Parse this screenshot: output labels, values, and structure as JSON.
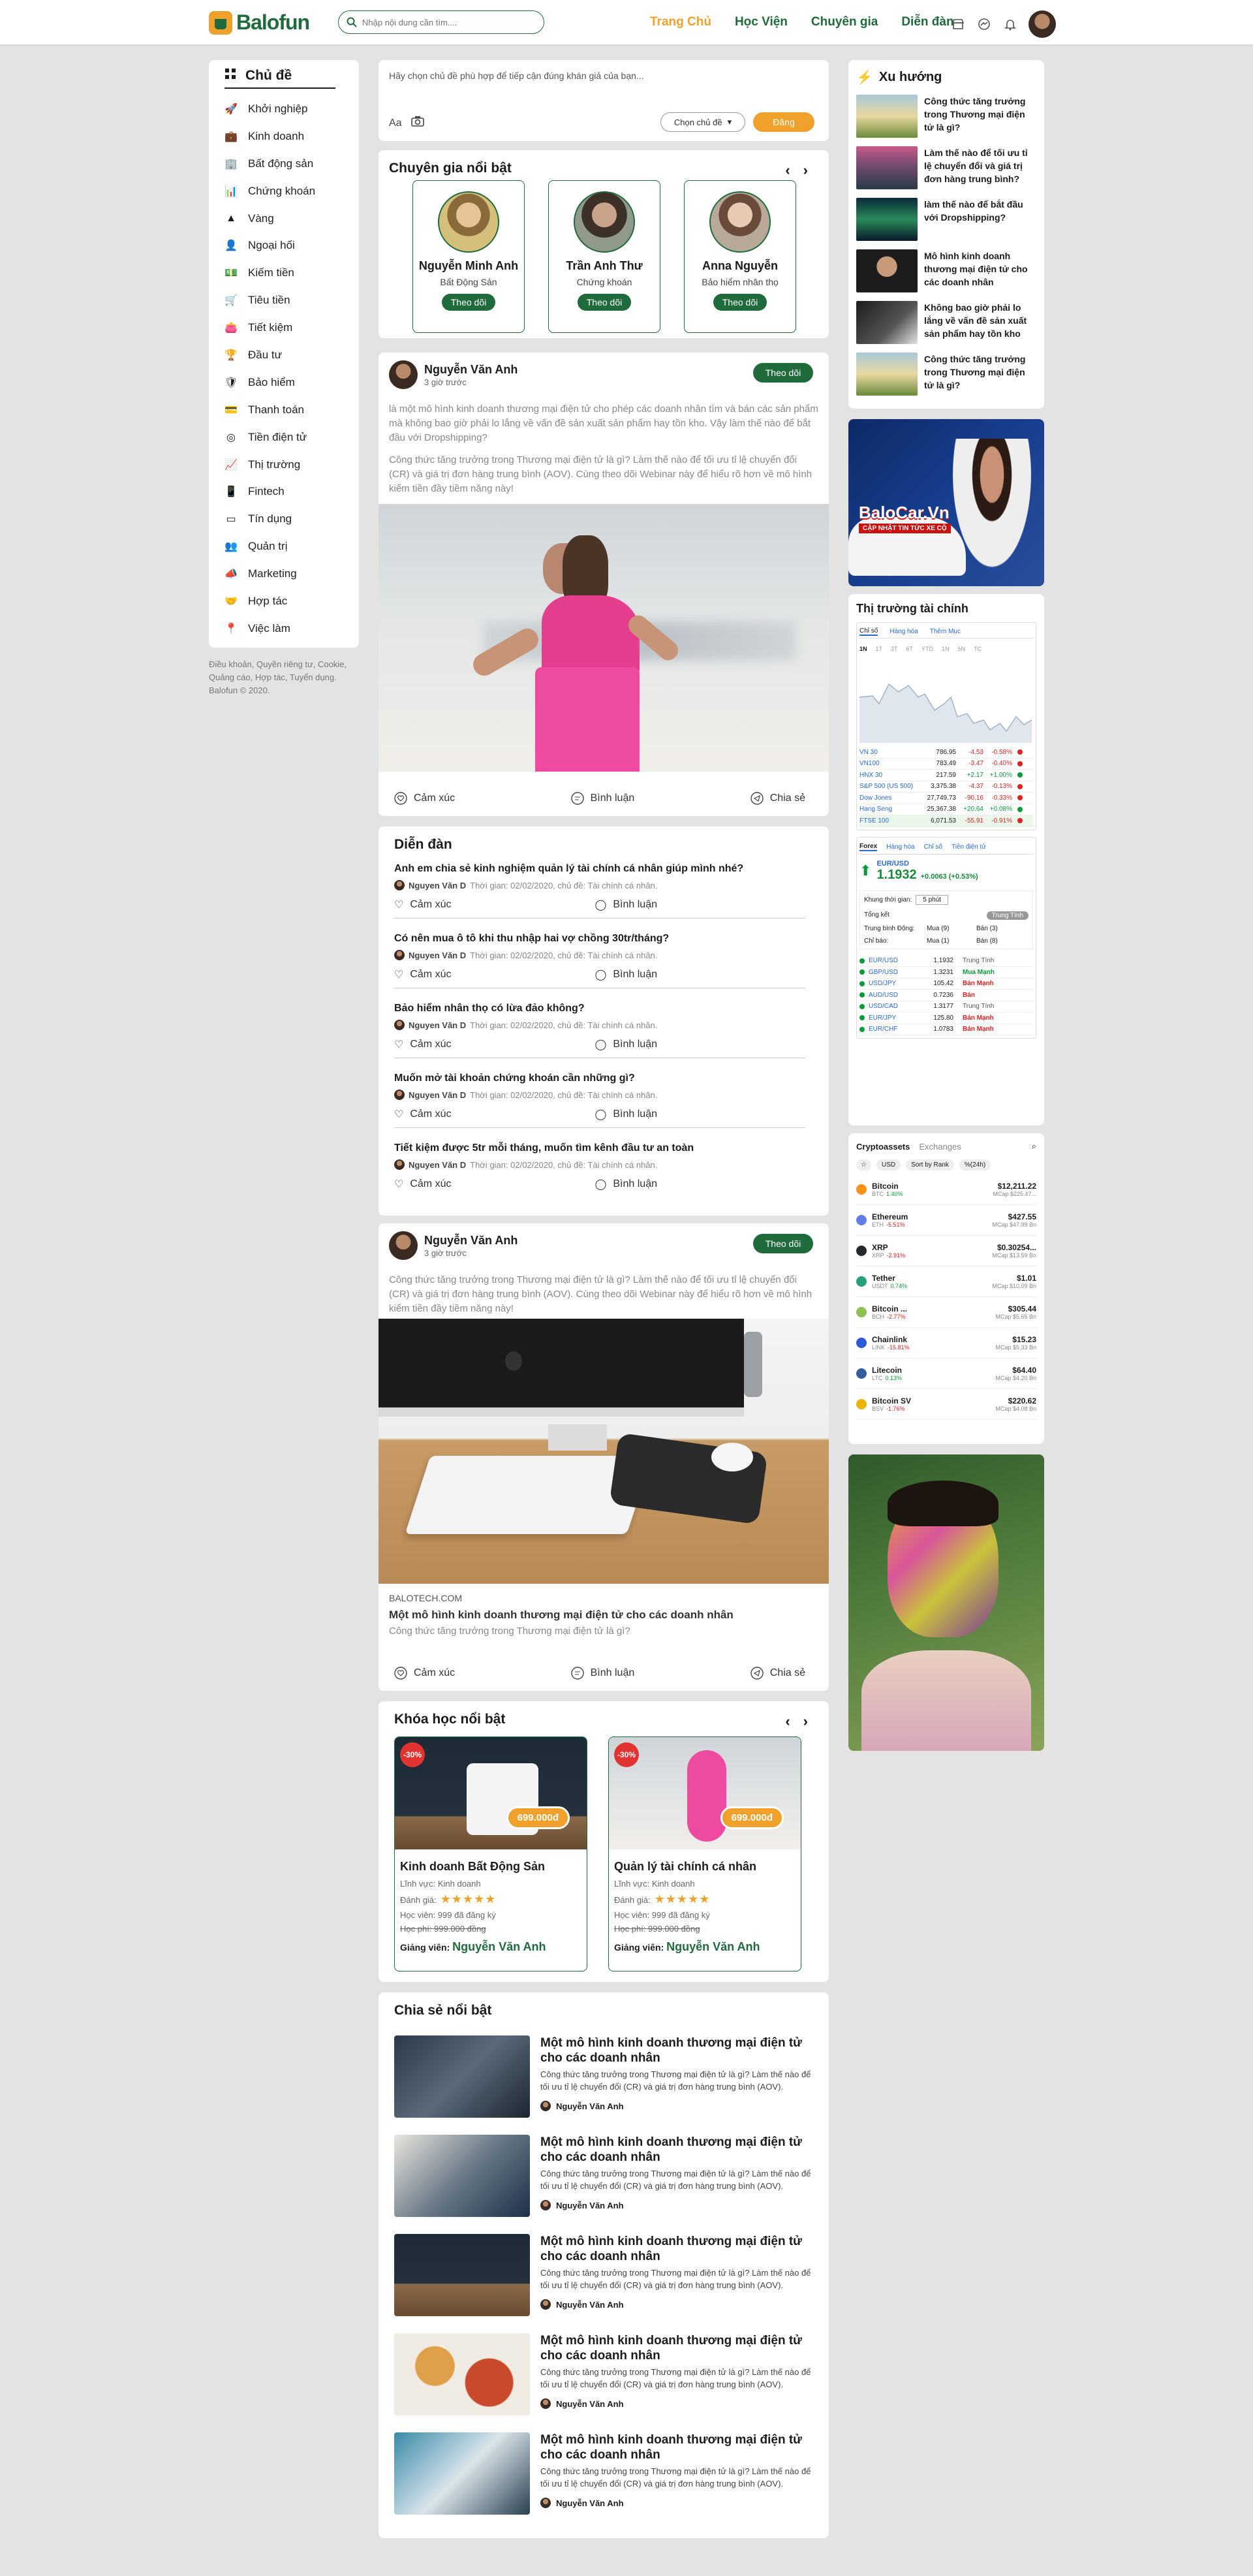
{
  "header": {
    "logo": "Balofun",
    "search_placeholder": "Nhập nội dung cần tìm....",
    "nav": [
      "Trang Chủ",
      "Học Viện",
      "Chuyên gia",
      "Diễn đàn"
    ]
  },
  "sidebar": {
    "title": "Chủ đề",
    "items": [
      "Khởi nghiệp",
      "Kinh doanh",
      "Bất động sản",
      "Chứng khoán",
      "Vàng",
      "Ngoại hối",
      "Kiếm tiền",
      "Tiêu tiền",
      "Tiết kiệm",
      "Đầu tư",
      "Bảo hiểm",
      "Thanh toán",
      "Tiền điện tử",
      "Thị trường",
      "Fintech",
      "Tín dụng",
      "Quản trị",
      "Marketing",
      "Hợp tác",
      "Việc làm"
    ],
    "icons": [
      "rocket-icon",
      "bag-icon",
      "building-icon",
      "chart-icon",
      "gold-icon",
      "person-icon",
      "person-money-icon",
      "cart-icon",
      "wallet-icon",
      "trophy-icon",
      "shield-icon",
      "card-icon",
      "coin-icon",
      "trend-icon",
      "phone-icon",
      "card2-icon",
      "people-icon",
      "megaphone-icon",
      "handshake-icon",
      "location-icon"
    ]
  },
  "footer": "Điều khoản, Quyền riêng tư, Cookie, Quảng cáo, Hợp tác, Tuyển dụng. Balofun © 2020.",
  "composer": {
    "placeholder": "Hãy chọn chủ đề phù hợp để tiếp cận đúng khán giả của bạn...",
    "aa": "Aa",
    "select": "Chọn chủ đề",
    "post": "Đăng"
  },
  "experts": {
    "title": "Chuyên gia nổi bật",
    "items": [
      {
        "name": "Nguyễn Minh Anh",
        "field": "Bất Động Sản",
        "follow": "Theo dõi"
      },
      {
        "name": "Trần Anh Thư",
        "field": "Chứng khoán",
        "follow": "Theo dõi"
      },
      {
        "name": "Anna Nguyễn",
        "field": "Bảo hiểm nhân thọ",
        "follow": "Theo dõi"
      }
    ]
  },
  "post1": {
    "author": "Nguyễn Văn Anh",
    "time": "3 giờ trước",
    "follow": "Theo dõi",
    "p1": "là một mô hình kinh doanh thương mại điện tử cho phép các doanh nhân tìm và bán các sản phẩm mà không bao giờ phải lo lắng về vấn đề sản xuất sản phẩm hay tồn kho. Vậy làm thế nào để bắt  đầu với Dropshipping?",
    "p2": "Công thức tăng trưởng trong Thương mại điện tử là gì? Làm thế nào để tối ưu tỉ lệ chuyển đổi (CR) và giá trị đơn hàng trung bình (AOV). Cùng theo dõi Webinar này để hiểu rõ hơn về mô hình kiếm tiền đầy tiềm năng này!",
    "actions": [
      "Cảm xúc",
      "Bình luận",
      "Chia sẻ"
    ]
  },
  "forum": {
    "title": "Diễn đàn",
    "items": [
      {
        "q": "Anh em chia sẻ kinh nghiệm quản lý tài chính cá nhân giúp mình nhé?",
        "author": "Nguyen Văn D",
        "meta": "Thời gian: 02/02/2020, chủ đề: Tài chính cá nhân."
      },
      {
        "q": "Có nên mua ô tô khi thu nhập hai vợ chồng 30tr/tháng?",
        "author": "Nguyen Văn D",
        "meta": "Thời gian: 02/02/2020, chủ đề: Tài chính cá nhân."
      },
      {
        "q": "Bảo hiểm nhân thọ có lừa đảo không?",
        "author": "Nguyen Văn D",
        "meta": "Thời gian: 02/02/2020, chủ đề: Tài chính cá nhân."
      },
      {
        "q": "Muốn mở tài khoản chứng khoán cần những gì?",
        "author": "Nguyen Văn D",
        "meta": "Thời gian: 02/02/2020, chủ đề: Tài chính cá nhân."
      },
      {
        "q": "Tiết kiệm được 5tr mỗi tháng, muốn tìm kênh đầu tư an toàn",
        "author": "Nguyen Văn D",
        "meta": "Thời gian: 02/02/2020, chủ đề: Tài chính cá nhân."
      }
    ],
    "actions": [
      "Cảm xúc",
      "Bình luận"
    ]
  },
  "post2": {
    "author": "Nguyễn Văn Anh",
    "time": "3 giờ trước",
    "follow": "Theo dõi",
    "p": "Công thức tăng trưởng trong Thương mại điện tử là gì? Làm thế nào để tối ưu tỉ lệ chuyển đổi (CR) và giá trị đơn hàng trung bình (AOV). Cùng theo dõi Webinar này để hiểu rõ hơn về mô hình kiếm tiền đầy tiềm năng này!",
    "domain": "BALOTECH.COM",
    "link_title": "Một mô hình kinh doanh thương mại điện tử cho các doanh nhân",
    "link_desc": "Công thức tăng trưởng trong Thương mại điện tử là gì?",
    "actions": [
      "Cảm xúc",
      "Bình luận",
      "Chia sẻ"
    ]
  },
  "courses": {
    "title": "Khóa học nổi bật",
    "items": [
      {
        "disc": "-30%",
        "price": "699.000đ",
        "name": "Kinh doanh Bất Động Sản",
        "field": "Lĩnh vực: Kinh doanh",
        "rating_label": "Đánh giá:",
        "rating": 5,
        "students": "Học viên: 999 đã đăng ký",
        "old_price": "Học phí: 999.000 đồng",
        "teacher_label": "Giảng viên:",
        "teacher": "Nguyễn Văn Anh"
      },
      {
        "disc": "-30%",
        "price": "699.000đ",
        "name": "Quản lý tài chính cá nhân",
        "field": "Lĩnh vực: Kinh doanh",
        "rating_label": "Đánh giá:",
        "rating": 5,
        "students": "Học viên: 999 đã đăng ký",
        "old_price": "Học phí: 999.000 đồng",
        "teacher_label": "Giảng viên:",
        "teacher": "Nguyễn Văn Anh"
      }
    ]
  },
  "shares": {
    "title": "Chia sẻ nổi bật",
    "items": [
      {
        "title": "Một mô hình kinh doanh thương mại điện tử cho các doanh nhân",
        "desc": "Công thức tăng trưởng trong Thương mại điện tử là gì? Làm thế nào để tối ưu tỉ lệ chuyển đổi (CR) và giá trị đơn hàng trung bình (AOV).",
        "author": "Nguyễn Văn Anh"
      },
      {
        "title": "Một mô hình kinh doanh thương mại điện tử cho các doanh nhân",
        "desc": "Công thức tăng trưởng trong Thương mại điện tử là gì? Làm thế nào để tối ưu tỉ lệ chuyển đổi (CR) và giá trị đơn hàng trung bình (AOV).",
        "author": "Nguyễn Văn Anh"
      },
      {
        "title": "Một mô hình kinh doanh thương mại điện tử cho các doanh nhân",
        "desc": "Công thức tăng trưởng trong Thương mại điện tử là gì? Làm thế nào để tối ưu tỉ lệ chuyển đổi (CR) và giá trị đơn hàng trung bình (AOV).",
        "author": "Nguyễn Văn Anh"
      },
      {
        "title": "Một mô hình kinh doanh thương mại điện tử cho các doanh nhân",
        "desc": "Công thức tăng trưởng trong Thương mại điện tử là gì? Làm thế nào để tối ưu tỉ lệ chuyển đổi (CR) và giá trị đơn hàng trung bình (AOV).",
        "author": "Nguyễn Văn Anh"
      },
      {
        "title": "Một mô hình kinh doanh thương mại điện tử cho các doanh nhân",
        "desc": "Công thức tăng trưởng trong Thương mại điện tử là gì? Làm thế nào để tối ưu tỉ lệ chuyển đổi (CR) và giá trị đơn hàng trung bình (AOV).",
        "author": "Nguyễn Văn Anh"
      }
    ]
  },
  "trend": {
    "title": "Xu hướng",
    "items": [
      "Công thức tăng trưởng trong Thương mại điện tử là gì?",
      "Làm thế nào để tối ưu tỉ lệ chuyển đổi và giá trị đơn hàng trung bình?",
      "làm thế nào để bắt  đầu với Dropshipping?",
      "Mô hình kinh doanh thương mại điện tử cho các doanh nhân",
      "Không bao giờ phải lo lắng về vấn đề sản xuất sản phẩm hay tồn kho",
      "Công thức tăng trưởng trong Thương mại điện tử là gì?"
    ]
  },
  "ad1": {
    "brand": "BaloCar.Vn",
    "tag": "CẬP NHẬT TIN TỨC XE CỘ"
  },
  "market": {
    "title": "Thị trường tài chính",
    "tabs": [
      "Chỉ số",
      "Hàng hóa",
      "Thêm Mục"
    ],
    "periods": [
      "1N",
      "1T",
      "3T",
      "6T",
      "YTD",
      "1N",
      "5N",
      "TC"
    ],
    "rows": [
      [
        "VN 30",
        "786.95",
        "-4.53",
        "-0.58%"
      ],
      [
        "VN100",
        "783.49",
        "-3.47",
        "-0.40%"
      ],
      [
        "HNX 30",
        "217.59",
        "+2.17",
        "+1.00%"
      ],
      [
        "S&P 500 (US 500)",
        "3,375.38",
        "-4.37",
        "-0.13%"
      ],
      [
        "Dow Jones",
        "27,749.73",
        "-90.16",
        "-0.33%"
      ],
      [
        "Hang Seng",
        "25,367.38",
        "+20.64",
        "+0.08%"
      ],
      [
        "FTSE 100",
        "6,071.53",
        "-55.91",
        "-0.91%"
      ]
    ],
    "fx_tabs": [
      "Forex",
      "Hàng hóa",
      "Chỉ số",
      "Tiền điện tử"
    ],
    "pair": "EUR/USD",
    "price": "1.1932",
    "change": "+0.0063 (+0.53%)",
    "timeframe_label": "Khung thời gian:",
    "timeframe": "5 phút",
    "summary_label": "Tổng kết",
    "summary_value": "Trung Tính",
    "ma_label": "Trung bình Động:",
    "ma_buy": "Mua (9)",
    "ma_sell": "Bán (3)",
    "ind_label": "Chỉ báo:",
    "ind_buy": "Mua (1)",
    "ind_sell": "Bán (8)",
    "fx_rows": [
      [
        "EUR/USD",
        "1.1932",
        "Trung Tính"
      ],
      [
        "GBP/USD",
        "1.3231",
        "Mua Mạnh"
      ],
      [
        "USD/JPY",
        "105.42",
        "Bán Mạnh"
      ],
      [
        "AUD/USD",
        "0.7236",
        "Bán"
      ],
      [
        "USD/CAD",
        "1.3177",
        "Trung Tính"
      ],
      [
        "EUR/JPY",
        "125.80",
        "Bán Mạnh"
      ],
      [
        "EUR/CHF",
        "1.0783",
        "Bán Mạnh"
      ]
    ]
  },
  "crypto": {
    "title": "Cryptoassets",
    "tab2": "Exchanges",
    "filters": [
      "USD",
      "Sort by Rank",
      "%(24h)"
    ],
    "rows": [
      {
        "name": "Bitcoin",
        "sym": "BTC",
        "chg": "1.40%",
        "price": "$12,211.22",
        "cap": "MCap $225.47..."
      },
      {
        "name": "Ethereum",
        "sym": "ETH",
        "chg": "-5.51%",
        "price": "$427.55",
        "cap": "MCap $47.99 Bn"
      },
      {
        "name": "XRP",
        "sym": "XRP",
        "chg": "-2.91%",
        "price": "$0.30254...",
        "cap": "MCap $13.59 Bn"
      },
      {
        "name": "Tether",
        "sym": "USDT",
        "chg": "0.74%",
        "price": "$1.01",
        "cap": "MCap $10.09 Bn"
      },
      {
        "name": "Bitcoin ...",
        "sym": "BCH",
        "chg": "-2.77%",
        "price": "$305.44",
        "cap": "MCap $5.65 Bn"
      },
      {
        "name": "Chainlink",
        "sym": "LINK",
        "chg": "-15.81%",
        "price": "$15.23",
        "cap": "MCap $5.33 Bn"
      },
      {
        "name": "Litecoin",
        "sym": "LTC",
        "chg": "0.13%",
        "price": "$64.40",
        "cap": "MCap $4.20 Bn"
      },
      {
        "name": "Bitcoin SV",
        "sym": "BSV",
        "chg": "-1.76%",
        "price": "$220.62",
        "cap": "MCap $4.08 Bn"
      }
    ]
  },
  "colors": {
    "brand_green": "#1f6b3c",
    "accent_orange": "#f0a12c"
  }
}
